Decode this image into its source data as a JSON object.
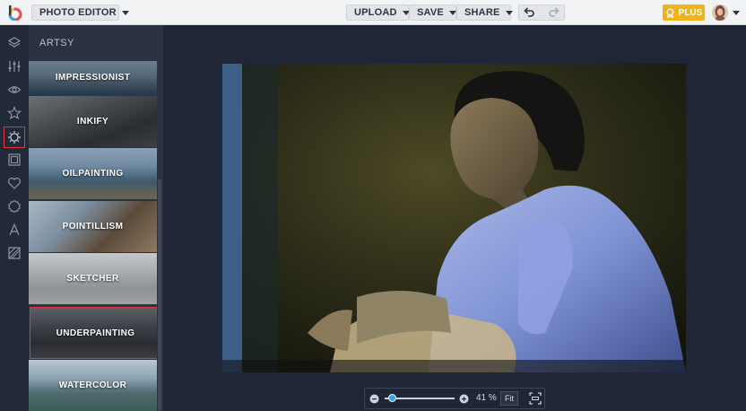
{
  "topbar": {
    "app_menu_label": "PHOTO EDITOR",
    "upload_label": "UPLOAD",
    "save_label": "SAVE",
    "share_label": "SHARE",
    "plus_label": "PLUS"
  },
  "rail": {
    "icons": [
      "layers-icon",
      "sliders-icon",
      "eye-icon",
      "star-icon",
      "artsy-effects-icon",
      "frame-icon",
      "heart-icon",
      "badge-icon",
      "text-icon",
      "texture-icon"
    ],
    "active": "artsy-effects-icon"
  },
  "panel": {
    "title": "ARTSY",
    "effects": [
      "IMPRESSIONIST",
      "INKIFY",
      "OILPAINTING",
      "POINTILLISM",
      "SKETCHER",
      "UNDERPAINTING",
      "WATERCOLOR"
    ],
    "selected": "UNDERPAINTING"
  },
  "zoom": {
    "percent_label": "41 %",
    "fit_label": "Fit",
    "level": 0.41
  },
  "colors": {
    "accent": "#e0353b",
    "plus": "#f0b318",
    "dark_bg": "#1f2635",
    "panel_bg": "#2b3343"
  }
}
